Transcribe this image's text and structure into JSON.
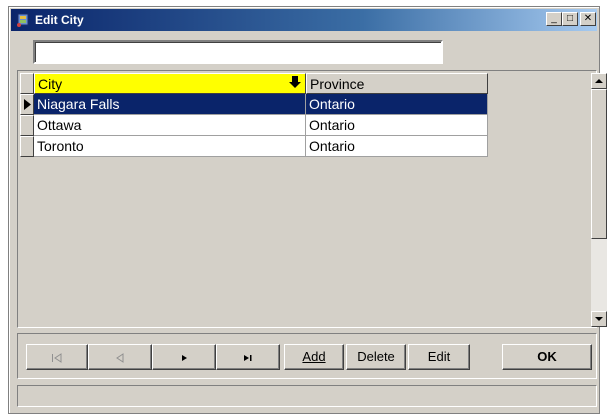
{
  "window": {
    "title": "Edit City",
    "minimize_label": "_",
    "maximize_label": "□",
    "close_label": "✕"
  },
  "search": {
    "value": "",
    "placeholder": ""
  },
  "grid": {
    "columns": [
      "City",
      "Province"
    ],
    "sort_indicator": "🡇",
    "rows": [
      {
        "city": "Niagara Falls",
        "province": "Ontario",
        "selected": true
      },
      {
        "city": "Ottawa",
        "province": "Ontario",
        "selected": false
      },
      {
        "city": "Toronto",
        "province": "Ontario",
        "selected": false
      }
    ],
    "row_pointer": "▶"
  },
  "navigator": {
    "first_label": "|◁",
    "prev_label": "◁",
    "next_label": "▶",
    "last_label": "▶|",
    "add_label": "Add",
    "delete_label": "Delete",
    "edit_label": "Edit",
    "ok_label": "OK"
  },
  "status": {
    "text": ""
  }
}
